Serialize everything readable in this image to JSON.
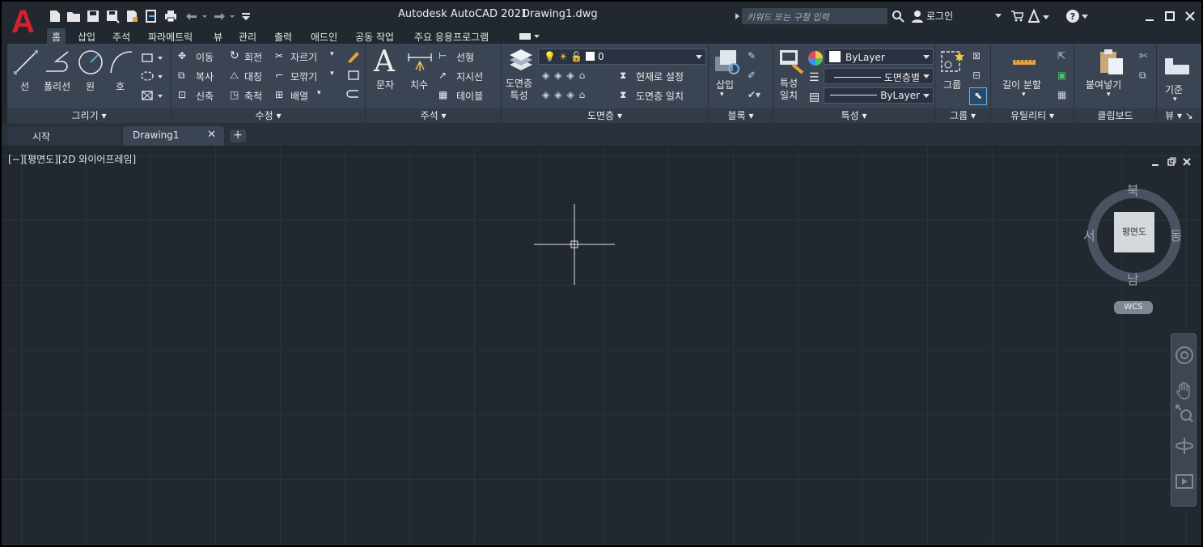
{
  "app": {
    "title": "Autodesk AutoCAD 2021",
    "file": "Drawing1.dwg",
    "logo": "A"
  },
  "search": {
    "placeholder": "키워드 또는 구절 입력"
  },
  "user": {
    "login": "로그인"
  },
  "ribbon_tabs": [
    "홈",
    "삽입",
    "주석",
    "파라메트릭",
    "뷰",
    "관리",
    "출력",
    "애드인",
    "공동 작업",
    "주요 응용프로그램"
  ],
  "panels": {
    "draw": {
      "title": "그리기",
      "items": [
        "선",
        "폴리선",
        "원",
        "호"
      ]
    },
    "modify": {
      "title": "수정",
      "items": [
        "이동",
        "회전",
        "자르기",
        "복사",
        "대칭",
        "모깎기",
        "신축",
        "축척",
        "배열"
      ]
    },
    "annotation": {
      "title": "주석",
      "items": [
        "문자",
        "치수",
        "선형",
        "지시선",
        "테이블"
      ]
    },
    "layers": {
      "title": "도면층",
      "props_label": "도면층\n특성",
      "layer_value": "0",
      "set_current": "현재로 설정",
      "match_layer": "도면층 일치"
    },
    "block": {
      "title": "블록",
      "insert": "삽입"
    },
    "properties": {
      "title": "특성",
      "match": "특성\n일치",
      "color": "ByLayer",
      "linetype": "도면층별",
      "lineweight": "ByLayer"
    },
    "groups": {
      "title": "그룹",
      "group": "그룹"
    },
    "utilities": {
      "title": "유틸리티",
      "measure": "길이 분할"
    },
    "clipboard": {
      "title": "클립보드",
      "paste": "붙여넣기"
    },
    "view": {
      "title": "뷰",
      "base": "기준"
    }
  },
  "file_tabs": [
    "시작",
    "Drawing1"
  ],
  "viewport": {
    "label": "[−][평면도][2D 와이어프레임]"
  },
  "viewcube": {
    "north": "북",
    "south": "남",
    "east": "동",
    "west": "서",
    "face": "평면도",
    "wcs": "WCS"
  },
  "colors": {
    "background": "#212830",
    "ribbon": "#3a4453",
    "logo": "#d4202f",
    "grid": "#2b323c"
  }
}
